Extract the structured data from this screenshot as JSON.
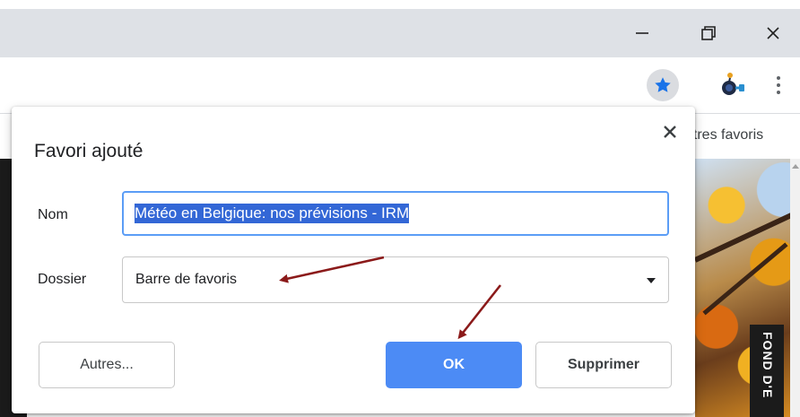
{
  "window_controls": {
    "minimize_glyph": "—",
    "maximize_glyph": "❐",
    "close_glyph": "✕"
  },
  "toolbar": {
    "star_icon": "star-icon",
    "extension_icon": "extension-icon",
    "menu_icon": "more-vert-icon",
    "accent_color": "#1a73e8"
  },
  "bookmarks_bar": {
    "other_bookmarks": "utres favoris"
  },
  "page": {
    "side_label": "FOND D'E"
  },
  "dialog": {
    "title": "Favori ajouté",
    "name_label": "Nom",
    "name_value": "Météo en Belgique: nos prévisions - IRM",
    "folder_label": "Dossier",
    "folder_value": "Barre de favoris",
    "more_button": "Autres...",
    "ok_button": "OK",
    "remove_button": "Supprimer",
    "close_icon": "close-icon"
  },
  "colors": {
    "titlebar_bg": "#dee1e6",
    "primary_button": "#4c8bf5",
    "selection_bg": "#3367d6",
    "input_focus_border": "#5b9df6",
    "annotation_arrow": "#8b1a1a"
  }
}
